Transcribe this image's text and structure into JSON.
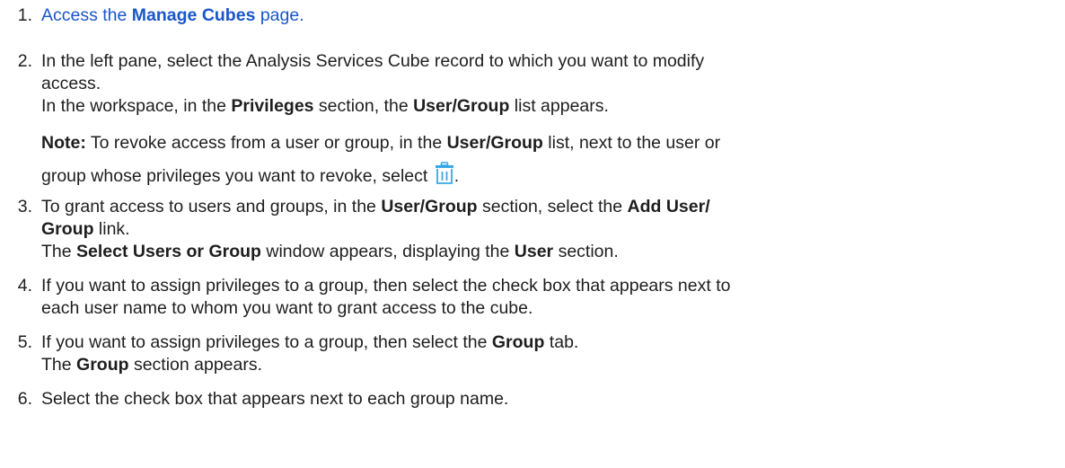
{
  "colors": {
    "link": "#1a56c8",
    "text": "#1e1e1e",
    "icon_blue": "#39a7e6"
  },
  "steps": [
    {
      "number": "1.",
      "prefix": "Access the ",
      "link_bold": "Manage Cubes",
      "suffix": " page."
    },
    {
      "number": "2.",
      "line1": "In the left pane, select the Analysis Services Cube record to which you want to modify",
      "line2": "access.",
      "result_a": "In the workspace, in the ",
      "result_b1": "Privileges",
      "result_c": " section, the ",
      "result_b2": "User/Group",
      "result_d": " list appears.",
      "note_label": "Note:",
      "note_a": " To revoke access from a user or group, in the ",
      "note_b": "User/Group",
      "note_c": " list, next to the user or",
      "note_line2": "group whose privileges you want to revoke, select ",
      "note_end": ".",
      "icon": "trash-icon"
    },
    {
      "number": "3.",
      "a": "To grant access to users and groups, in the ",
      "b1": "User/Group",
      "c": " section, select the ",
      "b2": "Add User/",
      "b3": "Group",
      "d": " link.",
      "result_a": "The ",
      "result_b1": "Select Users or Group",
      "result_c": " window appears, displaying the ",
      "result_b2": "User",
      "result_d": " section."
    },
    {
      "number": "4.",
      "line1": "If you want to assign privileges to a group, then select the check box that appears next to",
      "line2": "each user name to whom you want to grant access to the cube."
    },
    {
      "number": "5.",
      "a": "If you want to assign privileges to a group, then select the ",
      "b": "Group",
      "c": " tab.",
      "result_a": "The ",
      "result_b": "Group",
      "result_c": " section appears."
    },
    {
      "number": "6.",
      "line1": "Select the check box that appears next to each group name."
    }
  ]
}
